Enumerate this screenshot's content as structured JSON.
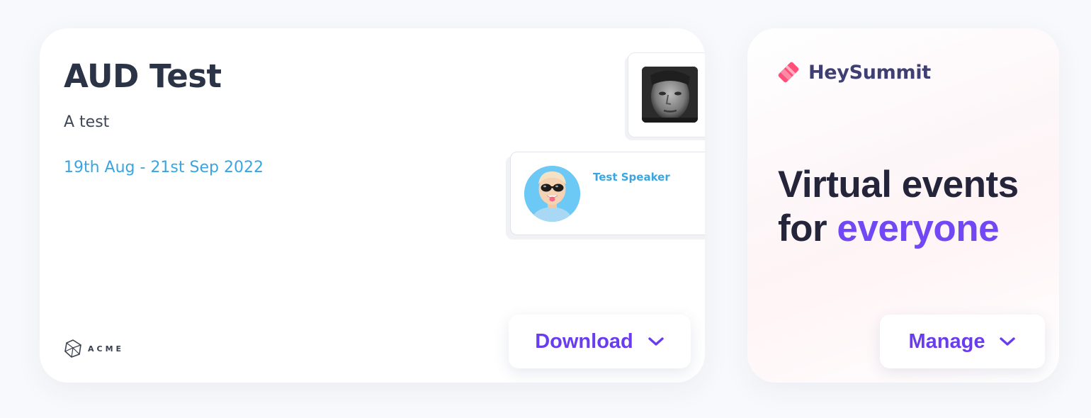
{
  "event": {
    "title": "AUD Test",
    "description": "A test",
    "dates": "19th Aug - 21st Sep 2022",
    "speaker_name": "Test Speaker",
    "organizer_logo_text": "ACME",
    "download_label": "Download"
  },
  "promo": {
    "brand_name": "HeySummit",
    "headline_line1": "Virtual events",
    "headline_line2_prefix": "for ",
    "headline_line2_accent": "everyone",
    "manage_label": "Manage"
  },
  "icons": {
    "download_chevron": "chevron-down-icon",
    "manage_chevron": "chevron-down-icon",
    "brand_logo": "heysummit-logo-icon",
    "organizer_logo": "acme-logo-icon"
  },
  "colors": {
    "accent_purple": "#6a3cf0",
    "date_blue": "#3aa5e0",
    "brand_pink": "#ff4f7a",
    "title_dark": "#2b3447"
  }
}
